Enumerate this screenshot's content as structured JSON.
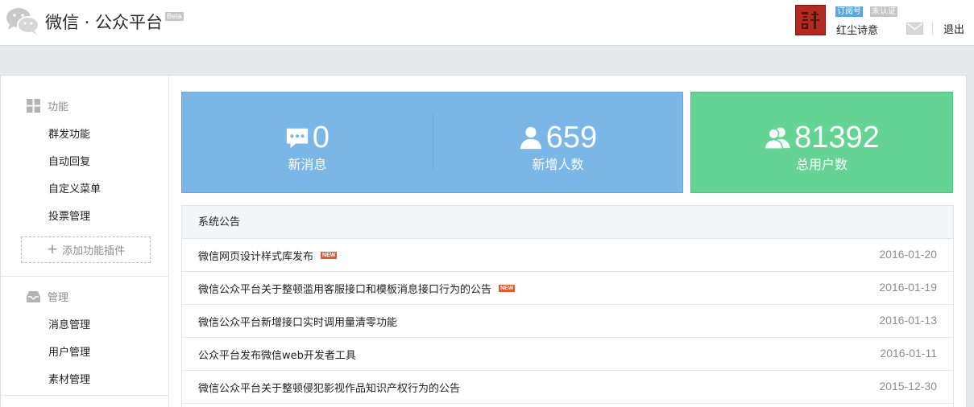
{
  "header": {
    "brand_title": "微信 · 公众平台",
    "beta_label": "Beta",
    "account_type_badge": "订阅号",
    "verification_badge": "未认证",
    "account_name": "红尘诗意",
    "logout_label": "退出",
    "icons": [
      "wechat-logo-icon",
      "mail-icon"
    ]
  },
  "sidebar": {
    "sections": [
      {
        "title": "功能",
        "icon": "grid-icon",
        "items": [
          "群发功能",
          "自动回复",
          "自定义菜单",
          "投票管理"
        ]
      },
      {
        "title": "管理",
        "icon": "inbox-icon",
        "items": [
          "消息管理",
          "用户管理",
          "素材管理"
        ]
      }
    ],
    "add_plugin_label": "添加功能插件"
  },
  "stats": {
    "new_messages": {
      "value": "0",
      "label": "新消息",
      "icon": "message-icon"
    },
    "new_followers": {
      "value": "659",
      "label": "新增人数",
      "icon": "user-icon"
    },
    "total_users": {
      "value": "81392",
      "label": "总用户数",
      "icon": "users-icon"
    }
  },
  "announcements": {
    "title": "系统公告",
    "new_badge": "NEW",
    "items": [
      {
        "title": "微信网页设计样式库发布",
        "date": "2016-01-20",
        "is_new": true
      },
      {
        "title": "微信公众平台关于整顿滥用客服接口和模板消息接口行为的公告",
        "date": "2016-01-19",
        "is_new": true
      },
      {
        "title": "微信公众平台新增接口实时调用量清零功能",
        "date": "2016-01-13",
        "is_new": false
      },
      {
        "title": "公众平台发布微信web开发者工具",
        "date": "2016-01-11",
        "is_new": false
      },
      {
        "title": "微信公众平台关于整顿侵犯影视作品知识产权行为的公告",
        "date": "2015-12-30",
        "is_new": false
      }
    ]
  },
  "colors": {
    "stat_blue": "#7ab7e6",
    "stat_green": "#64d394",
    "new_badge": "#e05a2b",
    "subscription_badge": "#58a8e3"
  }
}
